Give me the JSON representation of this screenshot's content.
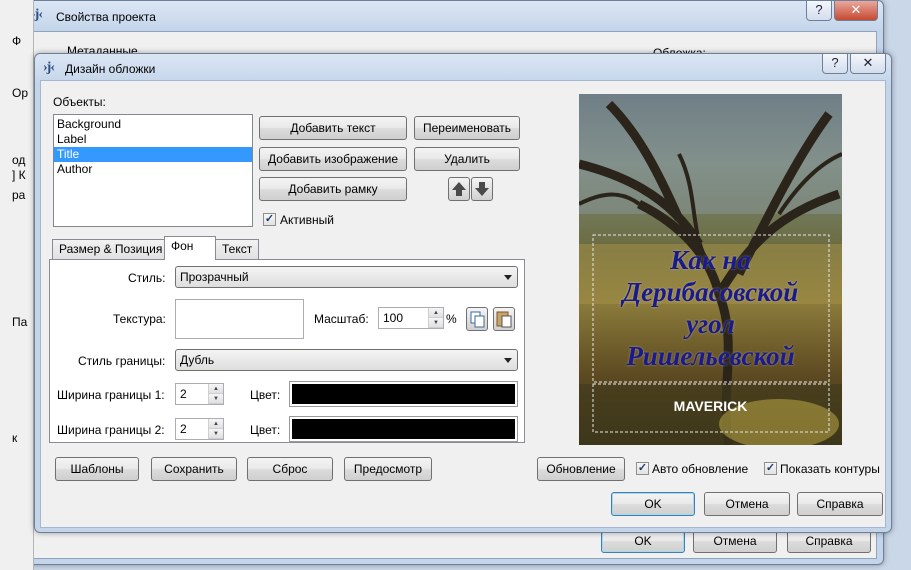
{
  "bg_window": {
    "title": "Свойства проекта",
    "help_btn": "?",
    "close_btn": "✕",
    "tree_item": "Метаданные",
    "cover_label": "Обложка:",
    "ok": "OK",
    "cancel": "Отмена",
    "help": "Справка",
    "left_frag": [
      "Ф",
      "Ор",
      "од",
      "] К",
      "ра",
      "Па",
      "к"
    ]
  },
  "dialog": {
    "title": "Дизайн обложки",
    "help_btn": "?",
    "close_btn": "✕",
    "objects_label": "Объекты:",
    "objects": [
      "Background",
      "Label",
      "Title",
      "Author"
    ],
    "selected_object": "Title",
    "buttons": {
      "add_text": "Добавить текст",
      "rename": "Переименовать",
      "add_image": "Добавить изображение",
      "delete": "Удалить",
      "add_frame": "Добавить рамку",
      "templates": "Шаблоны",
      "save": "Сохранить",
      "reset": "Сброс",
      "preview": "Предосмотр",
      "refresh": "Обновление",
      "ok": "OK",
      "cancel": "Отмена",
      "help": "Справка"
    },
    "active_checkbox": {
      "label": "Активный",
      "checked": true
    },
    "tabs": [
      "Размер & Позиция",
      "Фон",
      "Текст"
    ],
    "active_tab": "Фон",
    "bg_tab": {
      "style_label": "Стиль:",
      "style_value": "Прозрачный",
      "texture_label": "Текстура:",
      "scale_label": "Масштаб:",
      "scale_value": "100",
      "scale_unit": "%",
      "border_style_label": "Стиль границы:",
      "border_style_value": "Дубль",
      "border_width1_label": "Ширина границы 1:",
      "border_width1_value": "2",
      "border_width2_label": "Ширина границы 2:",
      "border_width2_value": "2",
      "color_label": "Цвет:",
      "color1": "#000000",
      "color2": "#000000"
    },
    "auto_update": {
      "label": "Авто обновление",
      "checked": true
    },
    "show_outlines": {
      "label": "Показать контуры",
      "checked": true
    },
    "cover_preview": {
      "title_lines": [
        "Как на",
        "Дерибасовской",
        "угол",
        "Ришельевской"
      ],
      "author": "MAVERICK",
      "title_color": "#1a1a8c"
    }
  }
}
